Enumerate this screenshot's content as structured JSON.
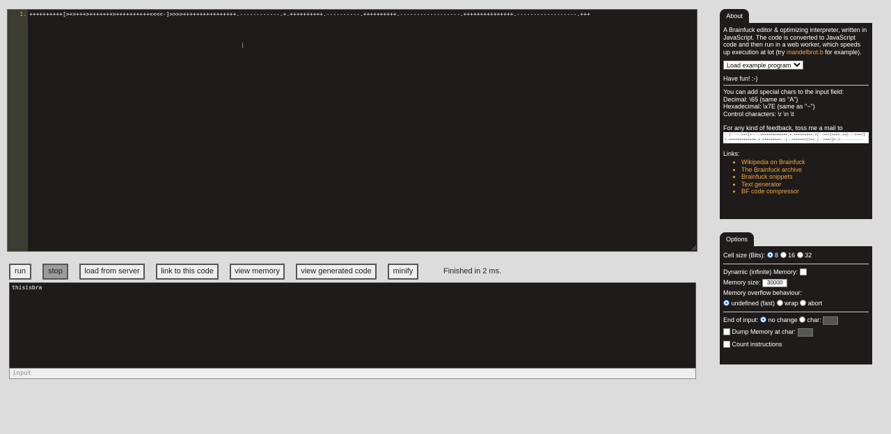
{
  "editor": {
    "line_number": "1.",
    "code": "++++++++++[>+>+++>+++++++>++++++++++<<<<-]>>>>++++++++++++++++.------------.+.++++++++++.----------.++++++++++.------------------.+++++++++++++++.------------------.+++"
  },
  "toolbar": {
    "run": "run",
    "stop": "stop",
    "load_server": "load from server",
    "link": "link to this code",
    "view_memory": "view memory",
    "view_generated": "view generated code",
    "minify": "minify",
    "status": "Finished in 2 ms."
  },
  "output": {
    "text": "thisisbra",
    "input_placeholder": "input"
  },
  "about": {
    "tab": "About",
    "intro_prefix": "A Brainfuck editor & optimizing interpreter, written in JavaScript. The code is converted to JavaScript code and then run in a web worker, which speeds up execution at lot (try ",
    "intro_link": "mandelbrot.b",
    "intro_suffix": " for example).",
    "example_select": "Load example program",
    "have_fun": "Have fun! :-)",
    "special_title": "You can add special chars to the input field:",
    "decimal": "Decimal: \\65 (same as \"A\")",
    "hex": "Hexadecimal: \\x7E (same as \"~\")",
    "control": "Control characters: \\r \\n \\t",
    "feedback": "For any kind of feedback, toss me a mail to",
    "mail_code": "--[----->+<]>---.+++++++++++++.+.+++++++++.+[-->+<]>+++.++[--->++<]>.+++++++++++++.+.+++++++++.-[-->+++++<]>++.[-->++<]>.<.---------.",
    "links_title": "Links:",
    "links": [
      "Wikipedia on Brainfuck",
      "The Brainfuck archive",
      "Brainfuck snippets",
      "Text generator",
      "BF code compressor"
    ]
  },
  "options": {
    "tab": "Options",
    "cell_size_label": "Cell size (Bits):",
    "cell_sizes": [
      "8",
      "16",
      "32"
    ],
    "dynamic_memory": "Dynamic (infinite) Memory:",
    "memory_size_label": "Memory size:",
    "memory_size_value": "30000",
    "overflow_label": "Memory overflow behaviour:",
    "overflow_options": [
      "undefined (fast)",
      "wrap",
      "abort"
    ],
    "eoi_label": "End of input:",
    "eoi_options": [
      "no change",
      "char:"
    ],
    "dump_label": "Dump Memory at char:",
    "count_label": "Count instructions"
  }
}
